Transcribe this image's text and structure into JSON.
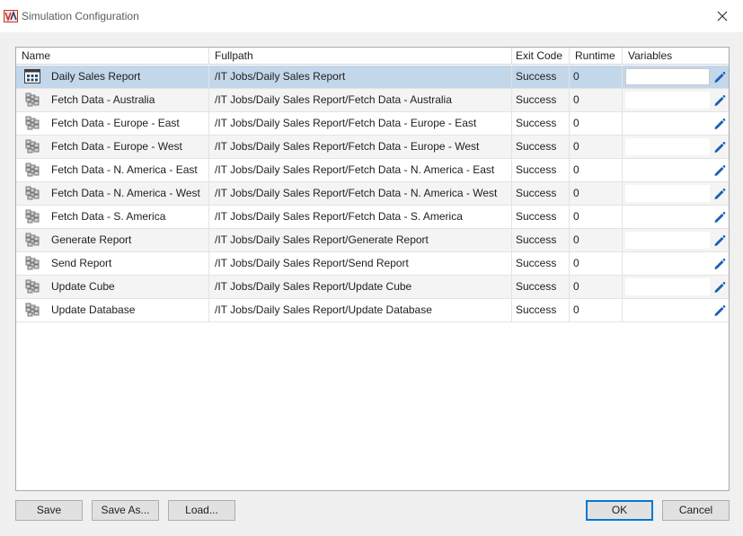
{
  "window": {
    "title": "Simulation Configuration"
  },
  "icons": {
    "app": "app-logo-icon",
    "close": "close-icon",
    "job": "job-stack-icon",
    "root": "job-group-icon",
    "edit": "pencil-icon"
  },
  "colors": {
    "selected_row": "#c3d7ea",
    "edit_icon": "#1a5fb4",
    "default_button_border": "#0078d7"
  },
  "grid": {
    "columns": [
      "Name",
      "Fullpath",
      "Exit Code",
      "Runtime",
      "Variables"
    ],
    "selected_index": 0,
    "rows": [
      {
        "name": "Daily Sales Report",
        "path": "/IT Jobs/Daily Sales Report",
        "exit": "Success",
        "runtime": "0",
        "variables": ""
      },
      {
        "name": "Fetch Data - Australia",
        "path": "/IT Jobs/Daily Sales Report/Fetch Data - Australia",
        "exit": "Success",
        "runtime": "0",
        "variables": ""
      },
      {
        "name": "Fetch Data - Europe - East",
        "path": "/IT Jobs/Daily Sales Report/Fetch Data - Europe - East",
        "exit": "Success",
        "runtime": "0",
        "variables": ""
      },
      {
        "name": "Fetch Data - Europe - West",
        "path": "/IT Jobs/Daily Sales Report/Fetch Data - Europe - West",
        "exit": "Success",
        "runtime": "0",
        "variables": ""
      },
      {
        "name": "Fetch Data - N. America - East",
        "path": "/IT Jobs/Daily Sales Report/Fetch Data - N. America - East",
        "exit": "Success",
        "runtime": "0",
        "variables": ""
      },
      {
        "name": "Fetch Data - N. America - West",
        "path": "/IT Jobs/Daily Sales Report/Fetch Data - N. America - West",
        "exit": "Success",
        "runtime": "0",
        "variables": ""
      },
      {
        "name": "Fetch Data - S. America",
        "path": "/IT Jobs/Daily Sales Report/Fetch Data - S. America",
        "exit": "Success",
        "runtime": "0",
        "variables": ""
      },
      {
        "name": "Generate Report",
        "path": "/IT Jobs/Daily Sales Report/Generate Report",
        "exit": "Success",
        "runtime": "0",
        "variables": ""
      },
      {
        "name": "Send Report",
        "path": "/IT Jobs/Daily Sales Report/Send Report",
        "exit": "Success",
        "runtime": "0",
        "variables": ""
      },
      {
        "name": "Update Cube",
        "path": "/IT Jobs/Daily Sales Report/Update Cube",
        "exit": "Success",
        "runtime": "0",
        "variables": ""
      },
      {
        "name": "Update Database",
        "path": "/IT Jobs/Daily Sales Report/Update Database",
        "exit": "Success",
        "runtime": "0",
        "variables": ""
      }
    ]
  },
  "buttons": {
    "save": "Save",
    "save_as": "Save As...",
    "load": "Load...",
    "ok": "OK",
    "cancel": "Cancel"
  }
}
